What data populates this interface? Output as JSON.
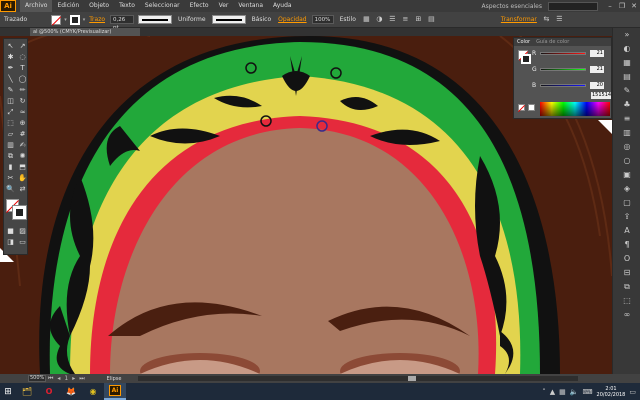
{
  "app": {
    "logo": "Ai",
    "workspace": "Aspectos esenciales"
  },
  "menu": [
    "Archivo",
    "Edición",
    "Objeto",
    "Texto",
    "Seleccionar",
    "Efecto",
    "Ver",
    "Ventana",
    "Ayuda"
  ],
  "window_controls": {
    "minimize": "–",
    "maximize": "❐",
    "close": "✕"
  },
  "control_bar": {
    "label": "Trazado",
    "stroke_label": "Trazo",
    "stroke_weight": "0,26 pt",
    "profile": "Uniforme",
    "brush": "Básico",
    "opacity_label": "Opacidad",
    "opacity_value": "100%",
    "style_label": "Estilo",
    "transform_label": "Transformar"
  },
  "document_tab": "al @500% (CMYK/Previsualizar)",
  "color_panel": {
    "tabs": [
      "Color",
      "Guía de color"
    ],
    "channels": [
      {
        "letter": "R",
        "value": "21",
        "color": "#e03030"
      },
      {
        "letter": "G",
        "value": "21",
        "color": "#30b030"
      },
      {
        "letter": "B",
        "value": "20",
        "color": "#3050e0"
      }
    ],
    "hex": "151514"
  },
  "status_bar": {
    "zoom": "500%",
    "page": "1",
    "tool": "Elipse"
  },
  "taskbar": {
    "apps": [
      {
        "name": "file-explorer",
        "icon": "🗂"
      },
      {
        "name": "opera",
        "icon": "O"
      },
      {
        "name": "firefox",
        "icon": "🦊"
      },
      {
        "name": "chrome",
        "icon": "◉"
      },
      {
        "name": "illustrator",
        "icon": "Ai"
      }
    ],
    "time": "2:01",
    "date": "20/02/2018"
  }
}
